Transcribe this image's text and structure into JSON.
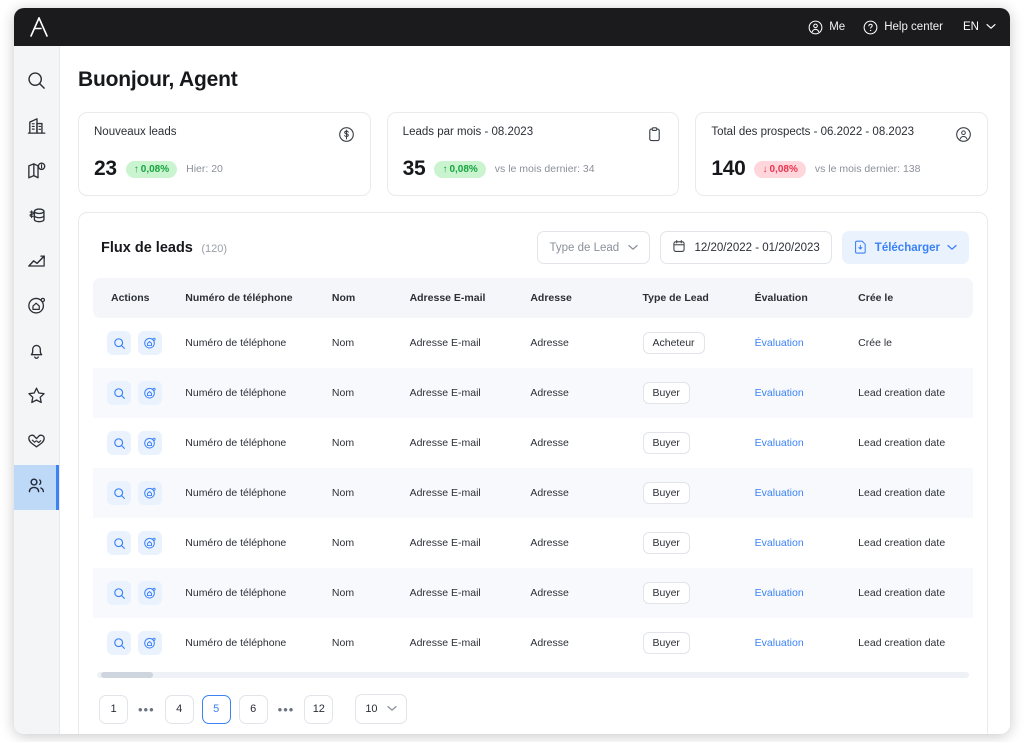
{
  "topbar": {
    "logo": "logo-a",
    "me_label": "Me",
    "help_label": "Help center",
    "lang_label": "EN"
  },
  "sidebar": {
    "items": [
      {
        "icon": "search-icon",
        "name": "search",
        "active": false
      },
      {
        "icon": "building-icon",
        "name": "buildings",
        "active": false
      },
      {
        "icon": "map-icon",
        "name": "map",
        "active": false
      },
      {
        "icon": "money-database-icon",
        "name": "finance",
        "active": false
      },
      {
        "icon": "chart-icon",
        "name": "analytics",
        "active": false
      },
      {
        "icon": "home-circle-icon",
        "name": "properties",
        "active": false
      },
      {
        "icon": "bell-icon",
        "name": "notifications",
        "active": false
      },
      {
        "icon": "star-icon",
        "name": "favorites",
        "active": false
      },
      {
        "icon": "handshake-heart-icon",
        "name": "deals",
        "active": false
      },
      {
        "icon": "people-icon",
        "name": "leads",
        "active": true
      }
    ]
  },
  "page": {
    "title": "Buonjour, Agent"
  },
  "kpi_cards": [
    {
      "label": "Nouveaux leads",
      "value": "23",
      "badge": "0,08%",
      "direction": "up",
      "sub": "Hier: 20",
      "icon": "dollar-circle-icon"
    },
    {
      "label": "Leads par mois - 08.2023",
      "value": "35",
      "badge": "0,08%",
      "direction": "up",
      "sub": "vs le mois dernier: 34",
      "icon": "clipboard-icon"
    },
    {
      "label": "Total des prospects - 06.2022 - 08.2023",
      "value": "140",
      "badge": "0,08%",
      "direction": "down",
      "sub": "vs le mois dernier: 138",
      "icon": "person-circle-icon"
    }
  ],
  "panel": {
    "title": "Flux de leads",
    "count": "(120)",
    "filter_type_label": "Type de Lead",
    "date_range": "12/20/2022 - 01/20/2023",
    "download_label": "Télécharger"
  },
  "table": {
    "columns": [
      "Actions",
      "Numéro de téléphone",
      "Nom",
      "Adresse E-mail",
      "Adresse",
      "Type de Lead",
      "Évaluation",
      "Crée le"
    ],
    "rows": [
      {
        "phone": "Numéro de téléphone",
        "name": "Nom",
        "email": "Adresse E-mail",
        "address": "Adresse",
        "type": "Acheteur",
        "evaluation": "Évaluation",
        "created": "Crée le"
      },
      {
        "phone": "Numéro de téléphone",
        "name": "Nom",
        "email": "Adresse E-mail",
        "address": "Adresse",
        "type": "Buyer",
        "evaluation": "Evaluation",
        "created": "Lead creation date"
      },
      {
        "phone": "Numéro de téléphone",
        "name": "Nom",
        "email": "Adresse E-mail",
        "address": "Adresse",
        "type": "Buyer",
        "evaluation": "Evaluation",
        "created": "Lead creation date"
      },
      {
        "phone": "Numéro de téléphone",
        "name": "Nom",
        "email": "Adresse E-mail",
        "address": "Adresse",
        "type": "Buyer",
        "evaluation": "Evaluation",
        "created": "Lead creation date"
      },
      {
        "phone": "Numéro de téléphone",
        "name": "Nom",
        "email": "Adresse E-mail",
        "address": "Adresse",
        "type": "Buyer",
        "evaluation": "Evaluation",
        "created": "Lead creation date"
      },
      {
        "phone": "Numéro de téléphone",
        "name": "Nom",
        "email": "Adresse E-mail",
        "address": "Adresse",
        "type": "Buyer",
        "evaluation": "Evaluation",
        "created": "Lead creation date"
      },
      {
        "phone": "Numéro de téléphone",
        "name": "Nom",
        "email": "Adresse E-mail",
        "address": "Adresse",
        "type": "Buyer",
        "evaluation": "Evaluation",
        "created": "Lead creation date"
      }
    ],
    "row_actions": [
      "search-icon",
      "home-circle-icon"
    ]
  },
  "pagination": {
    "pages": [
      "1",
      "...",
      "4",
      "5",
      "6",
      "...",
      "12"
    ],
    "active_page": "5",
    "page_size": "10"
  },
  "colors": {
    "accent": "#3b82f6",
    "accent_soft": "#eaf2fe",
    "positive_bg": "#c9f4cf",
    "positive_text": "#17a33f",
    "negative_bg": "#ffd6dc",
    "negative_text": "#e8344e",
    "topbar_bg": "#1b1b1d",
    "sidebar_bg": "#f4f5f7",
    "sidebar_active_bg": "#bed8f7",
    "header_bg": "#f4f6f9",
    "row_alt_bg": "#f7f9fc"
  }
}
